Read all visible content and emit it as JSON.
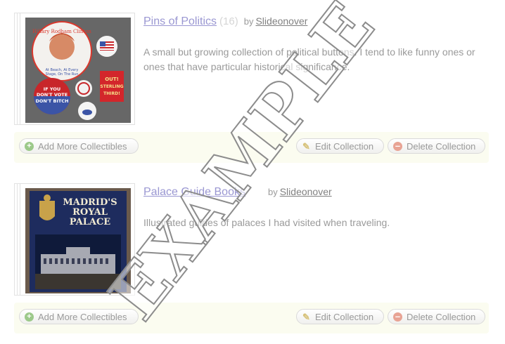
{
  "collections": [
    {
      "title": "Pins of Politics",
      "count": "(16)",
      "by": "by",
      "owner": "Slideonover",
      "description": "A small but growing collection of political buttons. I tend to like funny ones or ones that have particular historical significance.",
      "buttons": {
        "add": "Add More Collectibles",
        "edit": "Edit Collection",
        "delete": "Delete Collection"
      },
      "image": {
        "pins": [
          {
            "text": "Hillary Rodham Clinton / At Beach, At Every Stage, On The Run",
            "color": "#d9382d"
          },
          {
            "text": "",
            "color": "#3b54a6"
          },
          {
            "text": "IF YOU DON'T VOTE DON'T BITCH",
            "color": "#c8262a"
          },
          {
            "text": "",
            "color": "#c8262a"
          },
          {
            "text": "OUT! STERLING THIRD!",
            "color": "#d3262b"
          },
          {
            "text": "",
            "color": "#3b54a6"
          }
        ]
      }
    },
    {
      "title": "Palace Guide Books",
      "count": "",
      "by": "by",
      "owner": "Slideonover",
      "description": "Illustrated guides of palaces I had visited when traveling.",
      "buttons": {
        "add": "Add More Collectibles",
        "edit": "Edit Collection",
        "delete": "Delete Collection"
      },
      "image": {
        "line1": "MADRID'S",
        "line2": "ROYAL",
        "line3": "PALACE",
        "cover_color": "#1e2c5e"
      }
    }
  ],
  "watermark": "EXAMPLE",
  "icons": {
    "add": "plus-circle-icon",
    "edit": "pencil-icon",
    "delete": "minus-circle-icon"
  }
}
